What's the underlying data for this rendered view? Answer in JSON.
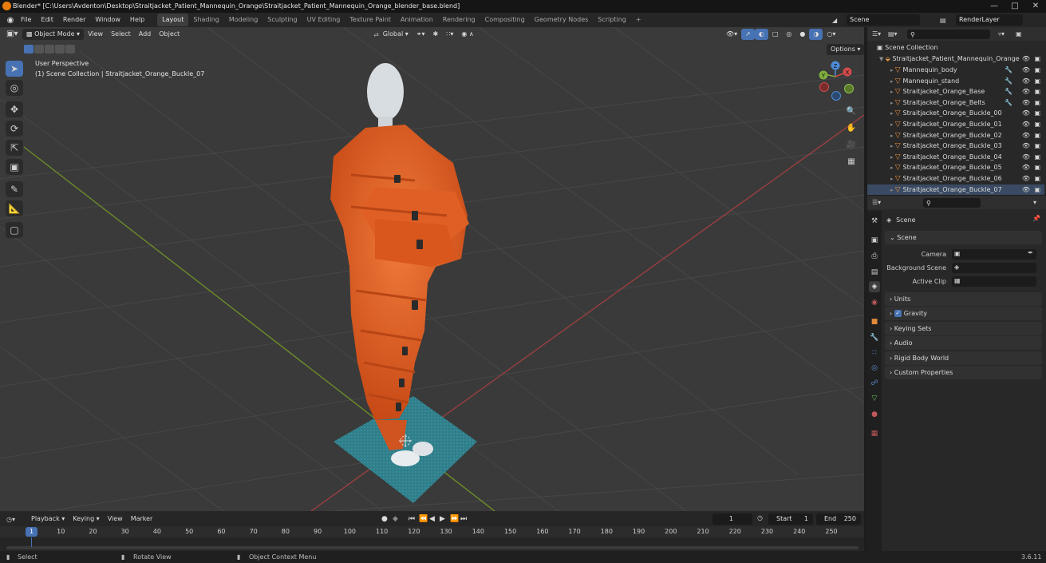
{
  "window": {
    "title": "Blender* [C:\\Users\\Avdenton\\Desktop\\Straitjacket_Patient_Mannequin_Orange\\Straitjacket_Patient_Mannequin_Orange_blender_base.blend]",
    "min_icon": "minimize-icon",
    "max_icon": "maximize-icon",
    "close_icon": "close-icon"
  },
  "menu": {
    "items": [
      "File",
      "Edit",
      "Render",
      "Window",
      "Help"
    ]
  },
  "workspaces": {
    "tabs": [
      "Layout",
      "Shading",
      "Modeling",
      "Sculpting",
      "UV Editing",
      "Texture Paint",
      "Animation",
      "Rendering",
      "Compositing",
      "Geometry Nodes",
      "Scripting"
    ],
    "active": "Layout",
    "add_label": "+"
  },
  "scene_selector": {
    "value": "Scene"
  },
  "view_layer": {
    "value": "RenderLayer"
  },
  "viewport": {
    "mode": "Object Mode",
    "menus": [
      "View",
      "Select",
      "Add",
      "Object"
    ],
    "transform_orientation": "Global",
    "options_label": "Options",
    "overlay_title": "User Perspective",
    "overlay_subtitle": "(1) Scene Collection | Straitjacket_Orange_Buckle_07",
    "gizmo": {
      "z": "Z",
      "y": "Y",
      "x": "X"
    }
  },
  "outliner": {
    "root": "Scene Collection",
    "collection": "Straitjacket_Patient_Mannequin_Orange",
    "items": [
      "Mannequin_body",
      "Mannequin_stand",
      "Straitjacket_Orange_Base",
      "Straitjacket_Orange_Belts",
      "Straitjacket_Orange_Buckle_00",
      "Straitjacket_Orange_Buckle_01",
      "Straitjacket_Orange_Buckle_02",
      "Straitjacket_Orange_Buckle_03",
      "Straitjacket_Orange_Buckle_04",
      "Straitjacket_Orange_Buckle_05",
      "Straitjacket_Orange_Buckle_06",
      "Straitjacket_Orange_Buckle_07"
    ],
    "selected_index": 11
  },
  "properties": {
    "context": "Scene",
    "panel_scene": "Scene",
    "fields": [
      {
        "label": "Camera"
      },
      {
        "label": "Background Scene"
      },
      {
        "label": "Active Clip"
      }
    ],
    "collapsed_panels": [
      "Units",
      "Gravity",
      "Keying Sets",
      "Audio",
      "Rigid Body World",
      "Custom Properties"
    ],
    "gravity_checked": true
  },
  "timeline": {
    "menus": [
      "Playback",
      "Keying",
      "View",
      "Marker"
    ],
    "current_frame": "1",
    "start_label": "Start",
    "start_value": "1",
    "end_label": "End",
    "end_value": "250",
    "ticks": [
      "1",
      "10",
      "20",
      "30",
      "40",
      "50",
      "60",
      "70",
      "80",
      "90",
      "100",
      "110",
      "120",
      "130",
      "140",
      "150",
      "160",
      "170",
      "180",
      "190",
      "200",
      "210",
      "220",
      "230",
      "240",
      "250"
    ]
  },
  "statusbar": {
    "select": "Select",
    "rotate": "Rotate View",
    "context_menu": "Object Context Menu",
    "version": "3.6.11"
  },
  "colors": {
    "accent": "#4772b3",
    "orange_object": "#e8622a",
    "floor_plane": "#2f7e8a"
  }
}
